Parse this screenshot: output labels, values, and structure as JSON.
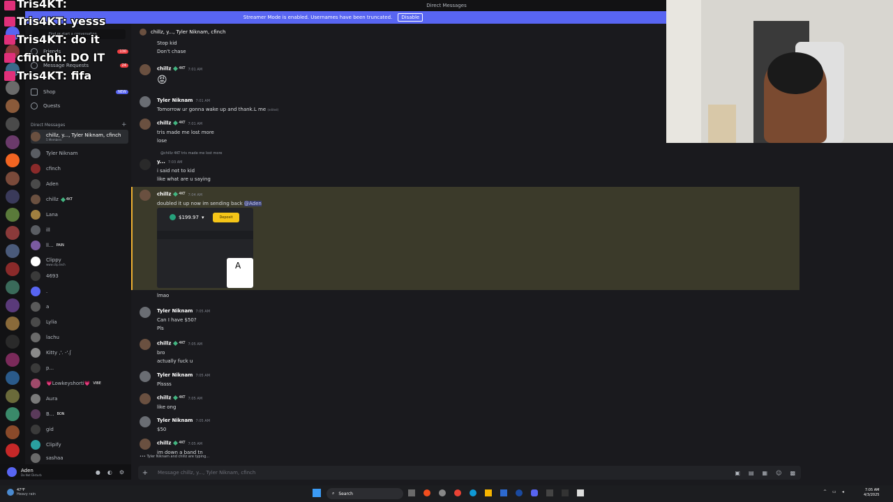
{
  "window": {
    "title": "Direct Messages"
  },
  "banner": {
    "text": "Streamer Mode is enabled. Usernames have been truncated.",
    "button": "Disable"
  },
  "dm_panel": {
    "search_placeholder": "Find or start a conversation",
    "nav": [
      {
        "label": "Friends",
        "badge": "130"
      },
      {
        "label": "Message Requests",
        "badge": "24"
      },
      {
        "label": "Shop",
        "badge": "NEW"
      },
      {
        "label": "Quests"
      }
    ],
    "section": "Direct Messages",
    "items": [
      {
        "label": "chillz, y..., Tyler Niknam, cfinch",
        "sub": "5 Members",
        "selected": true
      },
      {
        "label": "Tyler Niknam"
      },
      {
        "label": "cfinch"
      },
      {
        "label": "Aden"
      },
      {
        "label": "chillz",
        "tag": "4KT"
      },
      {
        "label": "Lana"
      },
      {
        "label": "ill"
      },
      {
        "label": "ll...",
        "tag": "PAIN"
      },
      {
        "label": "Clippy",
        "sub": "www.clip.tech"
      },
      {
        "label": "4693"
      },
      {
        "label": "."
      },
      {
        "label": "a"
      },
      {
        "label": "Lylia"
      },
      {
        "label": "lachu"
      },
      {
        "label": "Kitty ,'. -'.ʃ"
      },
      {
        "label": "p..."
      },
      {
        "label": "💗Lowkeyshorti💗",
        "tag": "VIBE"
      },
      {
        "label": "Aura"
      },
      {
        "label": "B...",
        "tag": "BON"
      },
      {
        "label": "gid"
      },
      {
        "label": "Clipify"
      },
      {
        "label": "sashaa"
      }
    ]
  },
  "user": {
    "name": "Aden",
    "status": "Do Not Disturb"
  },
  "chat": {
    "header": "chillz, y..., Tyler Niknam, cfinch",
    "messages": [
      {
        "text": "Stop kid"
      },
      {
        "text": "Don't chase"
      },
      {
        "name": "chillz",
        "tag": "4KT",
        "time": "7:01 AM",
        "text": "😡"
      },
      {
        "name": "Tyler Niknam",
        "time": "7:01 AM",
        "text": "Tomorrow ur gonna wake up and thank.L me",
        "edited": "(edited)"
      },
      {
        "name": "chillz",
        "tag": "4KT",
        "time": "7:01 AM",
        "text": "tris made me lost more",
        "text2": "lose"
      },
      {
        "reply": "@chillz  4KT  tris made me lost more",
        "name": "y...",
        "time": "7:03 AM",
        "text": "i said not to kid",
        "text2": "like what are u saying"
      },
      {
        "name": "chillz",
        "tag": "4KT",
        "time": "7:04 AM",
        "text": "doubled it up now im sending back",
        "mention": "@Aden"
      },
      {
        "text": "lmao"
      },
      {
        "name": "Tyler Niknam",
        "time": "7:05 AM",
        "text": "Can I have $50?",
        "text2": "Pls"
      },
      {
        "name": "chillz",
        "tag": "4KT",
        "time": "7:05 AM",
        "text": "bro",
        "text2": "actually fuck u"
      },
      {
        "name": "Tyler Niknam",
        "time": "7:05 AM",
        "text": "Plssss"
      },
      {
        "name": "chillz",
        "tag": "4KT",
        "time": "7:05 AM",
        "text": "like ong"
      },
      {
        "name": "Tyler Niknam",
        "time": "7:05 AM",
        "text": "$50"
      },
      {
        "name": "chillz",
        "tag": "4KT",
        "time": "7:05 AM",
        "text": "im down a band tn"
      }
    ],
    "card": {
      "balance": "$199.97",
      "button": "Deposit",
      "card": "A"
    },
    "typing": "Tyler Niknam and chillz are typing...",
    "input_placeholder": "Message chillz, y..., Tyler Niknam, cfinch"
  },
  "overlay": [
    {
      "user": "Tris4KT",
      "text": ""
    },
    {
      "user": "Tris4KT",
      "text": "yesss"
    },
    {
      "user": "Tris4KT",
      "text": "do it"
    },
    {
      "user": "cfinchh",
      "text": "DO IT"
    },
    {
      "user": "Tris4KT",
      "text": "fifa"
    }
  ],
  "taskbar": {
    "weather_temp": "47°F",
    "weather_text": "Heavy rain",
    "search": "Search",
    "time": "7:05 AM",
    "date": "4/3/2025"
  }
}
